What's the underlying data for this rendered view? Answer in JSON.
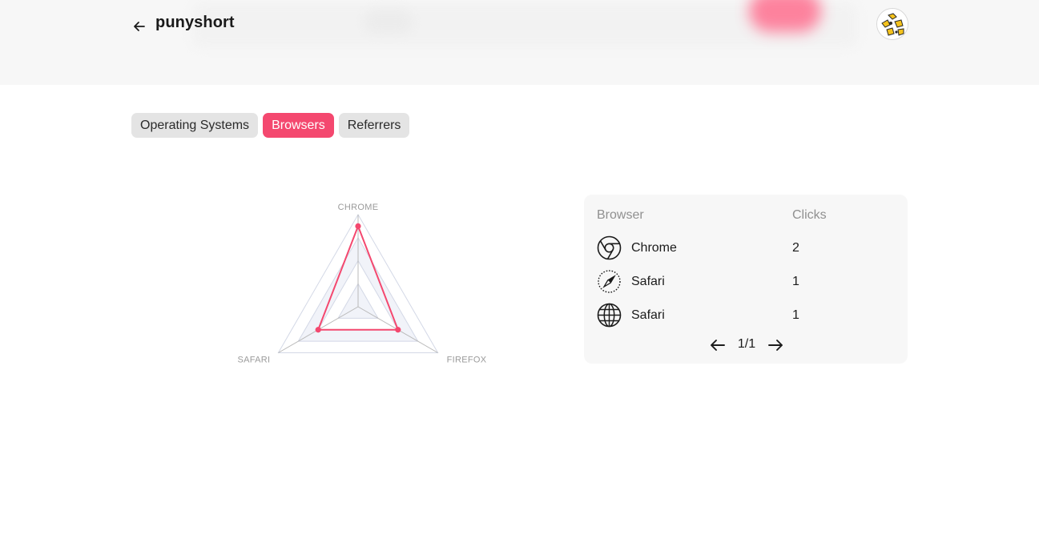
{
  "header": {
    "title": "punyshort"
  },
  "tabs": [
    {
      "label": "Operating Systems",
      "active": false
    },
    {
      "label": "Browsers",
      "active": true
    },
    {
      "label": "Referrers",
      "active": false
    }
  ],
  "chart_data": {
    "type": "radar",
    "axes": [
      "CHROME",
      "FIREFOX",
      "SAFARI"
    ],
    "values": [
      2,
      1,
      1
    ],
    "max": 2,
    "rings": 4,
    "series_color": "#f4486f",
    "grid_color": "#d3d8e6"
  },
  "table": {
    "headers": {
      "browser": "Browser",
      "clicks": "Clicks"
    },
    "rows": [
      {
        "icon": "chrome-icon",
        "name": "Chrome",
        "clicks": "2"
      },
      {
        "icon": "safari-compass-icon",
        "name": "Safari",
        "clicks": "1"
      },
      {
        "icon": "globe-icon",
        "name": "Safari",
        "clicks": "1"
      }
    ],
    "pagination": "1/1"
  },
  "colors": {
    "accent": "#f4486f",
    "tab_inactive": "#e4e4e4",
    "panel_bg": "#f7f7f7",
    "header_bg": "#f7f7f7"
  }
}
